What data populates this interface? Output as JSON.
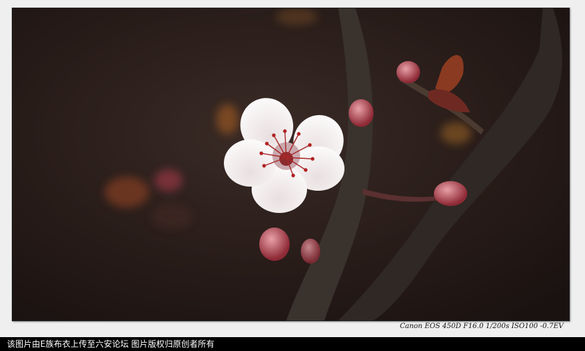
{
  "photo": {
    "subject": "white plum blossom on dark branch",
    "colors": {
      "background": "#2a1d1a",
      "petal": "#f2f0f0",
      "stamen": "#a8282a",
      "branch": "#3a322c",
      "bud": "#c24a5a"
    }
  },
  "exif_text": "Canon EOS 450D F16.0 1/200s ISO100 -0.7EV",
  "caption_text": "该图片由E族布衣上传至六安论坛  图片版权归原创者所有"
}
